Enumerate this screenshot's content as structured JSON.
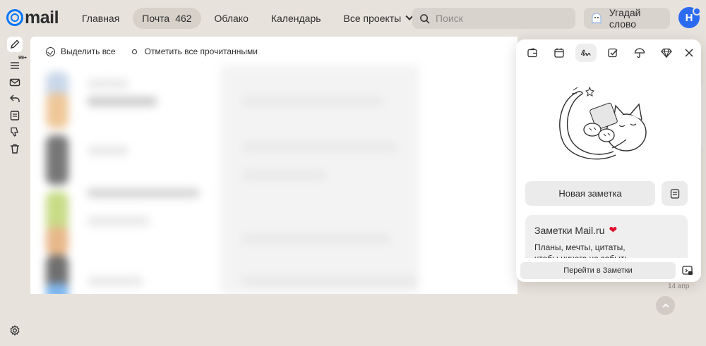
{
  "logo": {
    "text": "mail"
  },
  "nav": {
    "items": [
      {
        "label": "Главная"
      },
      {
        "label": "Почта",
        "count": "462"
      },
      {
        "label": "Облако"
      },
      {
        "label": "Календарь"
      },
      {
        "label": "Все проекты"
      }
    ]
  },
  "search": {
    "placeholder": "Поиск"
  },
  "game": {
    "label": "Угадай слово"
  },
  "user": {
    "initial": "Н"
  },
  "rail": {
    "badge": "99+"
  },
  "toolbar": {
    "select_all": "Выделить все",
    "mark_read": "Отметить все прочитанными"
  },
  "notes": {
    "new_note": "Новая заметка",
    "promo_title": "Заметки Mail.ru",
    "promo_text_1": "Планы, мечты, цитаты,",
    "promo_text_2": "чтобы ничего не забыть",
    "goto": "Перейти в Заметки"
  },
  "mail": {
    "last_date": "14 апр"
  },
  "colors": {
    "accent": "#0077ff",
    "avatar": "#2a6bf2",
    "heart": "#e0112b"
  }
}
